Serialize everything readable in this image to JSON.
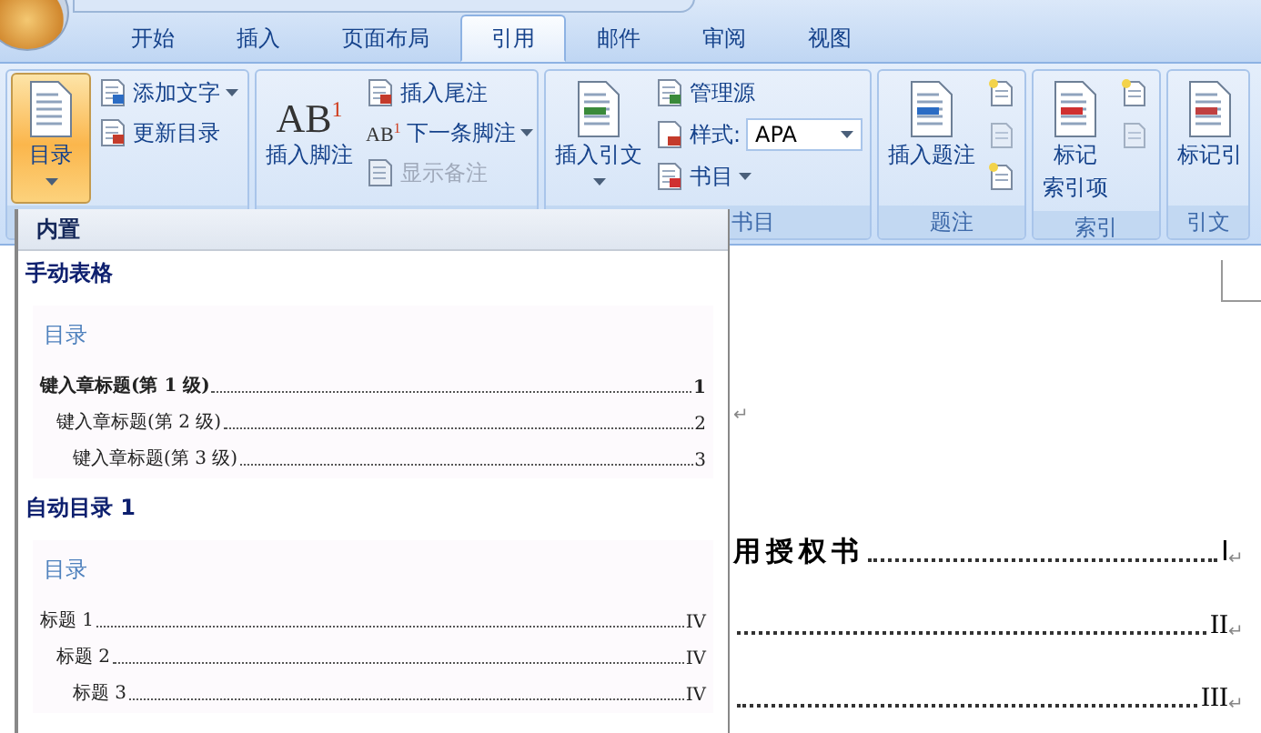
{
  "tabs": [
    {
      "label": "开始",
      "selected": false
    },
    {
      "label": "插入",
      "selected": false
    },
    {
      "label": "页面布局",
      "selected": false
    },
    {
      "label": "引用",
      "selected": true
    },
    {
      "label": "邮件",
      "selected": false
    },
    {
      "label": "审阅",
      "selected": false
    },
    {
      "label": "视图",
      "selected": false
    }
  ],
  "ribbon": {
    "groups": [
      {
        "items": [
          {
            "kind": "large",
            "label": "目录",
            "pressed": true,
            "dropdown": true
          },
          {
            "kind": "small",
            "label": "添加文字",
            "dropdown": true,
            "disabled": false
          },
          {
            "kind": "small",
            "label": "更新目录",
            "dropdown": false,
            "disabled": false
          }
        ]
      },
      {
        "items": [
          {
            "kind": "large",
            "label": "插入脚注",
            "pressed": false,
            "dropdown": false,
            "icon_text": "AB",
            "icon_sup": "1"
          },
          {
            "kind": "small",
            "label": "插入尾注",
            "dropdown": false,
            "disabled": false
          },
          {
            "kind": "small",
            "label": "下一条脚注",
            "dropdown": true,
            "disabled": false,
            "icon_text": "AB",
            "icon_sup": "1"
          },
          {
            "kind": "small",
            "label": "显示备注",
            "dropdown": false,
            "disabled": true
          }
        ]
      },
      {
        "label": "书目",
        "items": [
          {
            "kind": "large",
            "label": "插入引文",
            "pressed": false,
            "dropdown": true
          },
          {
            "kind": "small",
            "label": "管理源",
            "dropdown": false,
            "disabled": false
          },
          {
            "kind": "combo",
            "label": "样式:",
            "value": "APA"
          },
          {
            "kind": "small",
            "label": "书目",
            "dropdown": true,
            "disabled": false
          }
        ]
      },
      {
        "label": "题注",
        "items": [
          {
            "kind": "large",
            "label": "插入题注",
            "pressed": false,
            "dropdown": false
          },
          {
            "kind": "icons",
            "count_disabled": [
              false,
              true,
              false
            ]
          }
        ]
      },
      {
        "label": "索引",
        "items": [
          {
            "kind": "large",
            "label": "标记",
            "label_line2": "索引项",
            "pressed": false,
            "dropdown": false
          },
          {
            "kind": "icons",
            "count_disabled": [
              false,
              true
            ]
          }
        ]
      },
      {
        "label": "引文",
        "items": [
          {
            "kind": "large",
            "label": "标记引",
            "pressed": false,
            "dropdown": false
          }
        ]
      }
    ]
  },
  "toc_menu": {
    "header": "内置",
    "sections": [
      {
        "title": "手动表格",
        "preview_title": "目录",
        "entries": [
          {
            "text": "键入章标题(第 1 级)",
            "page": "1",
            "bold": true,
            "children": [
              {
                "text": "键入章标题(第 2 级)",
                "page": "2",
                "bold": false,
                "children": [
                  {
                    "text": "键入章标题(第 3 级)",
                    "page": "3",
                    "bold": false
                  }
                ]
              }
            ]
          }
        ]
      },
      {
        "title": "自动目录 1",
        "preview_title": "目录",
        "entries": [
          {
            "text": "标题 1",
            "page": "IV",
            "bold": false,
            "children": [
              {
                "text": "标题 2",
                "page": "IV",
                "bold": false,
                "children": [
                  {
                    "text": "标题 3",
                    "page": "IV",
                    "bold": false
                  }
                ]
              }
            ]
          }
        ]
      }
    ]
  },
  "document": {
    "blank_mark": "↵",
    "toc_lines": [
      {
        "title": "用授权书",
        "page": "Ⅰ",
        "mark": "↵"
      },
      {
        "page": "II",
        "mark": "↵"
      },
      {
        "page": "III",
        "mark": "↵"
      }
    ]
  }
}
